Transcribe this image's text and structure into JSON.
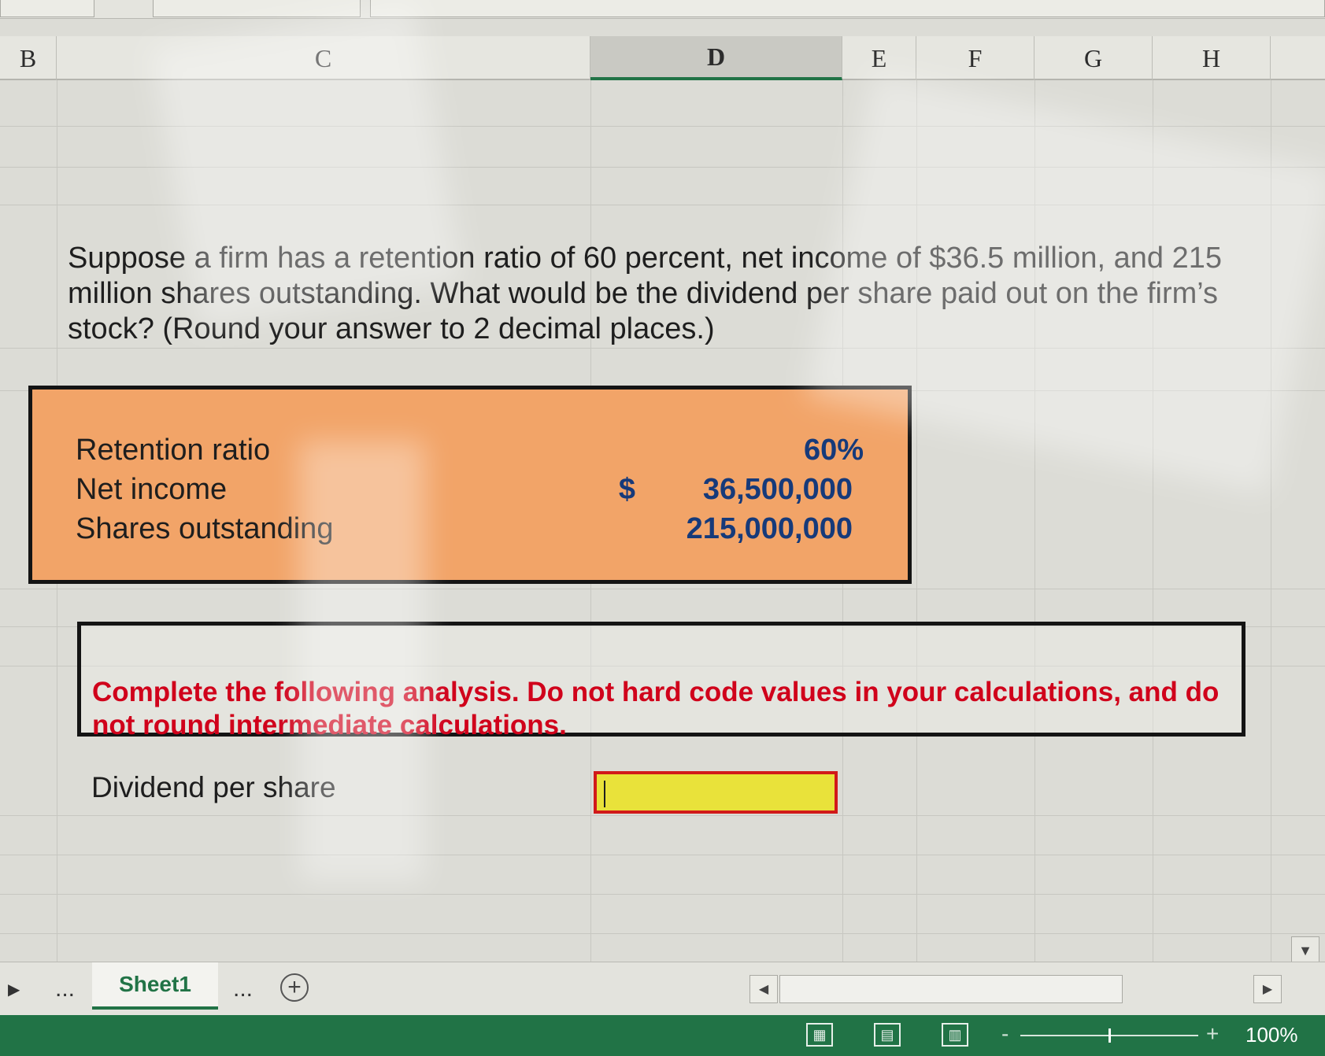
{
  "columns": [
    "B",
    "C",
    "D",
    "E",
    "F",
    "G",
    "H"
  ],
  "question": "Suppose a firm has a retention ratio of 60 percent, net income of $36.5 million, and 215 million shares outstanding. What would be the dividend per share paid out on the firm’s stock? (Round your answer to 2 decimal places.)",
  "inputs": {
    "retention_label": "Retention ratio",
    "retention_value": "60%",
    "net_income_label": "Net income",
    "currency_symbol": "$",
    "net_income_value": "36,500,000",
    "shares_label": "Shares outstanding",
    "shares_value": "215,000,000"
  },
  "instructions": "Complete the following analysis. Do not hard code values in your calculations, and do not round intermediate calculations.",
  "answer": {
    "label": "Dividend per share",
    "value": ""
  },
  "tab_bar": {
    "ellipsis": "...",
    "sheet_name": "Sheet1",
    "add_symbol": "+"
  },
  "status_bar": {
    "zoom": "100%",
    "zoom_fraction": 0.5
  },
  "colors": {
    "accent_green": "#217346",
    "input_orange": "#f2a468",
    "answer_yellow": "#e9e23a",
    "instruction_red": "#d0021b",
    "value_blue": "#163a7a"
  },
  "icons": [
    "play-arrow-icon",
    "add-sheet-icon",
    "scroll-left-icon",
    "scroll-right-icon",
    "scroll-down-icon",
    "normal-view-icon",
    "page-layout-icon",
    "page-break-icon"
  ]
}
